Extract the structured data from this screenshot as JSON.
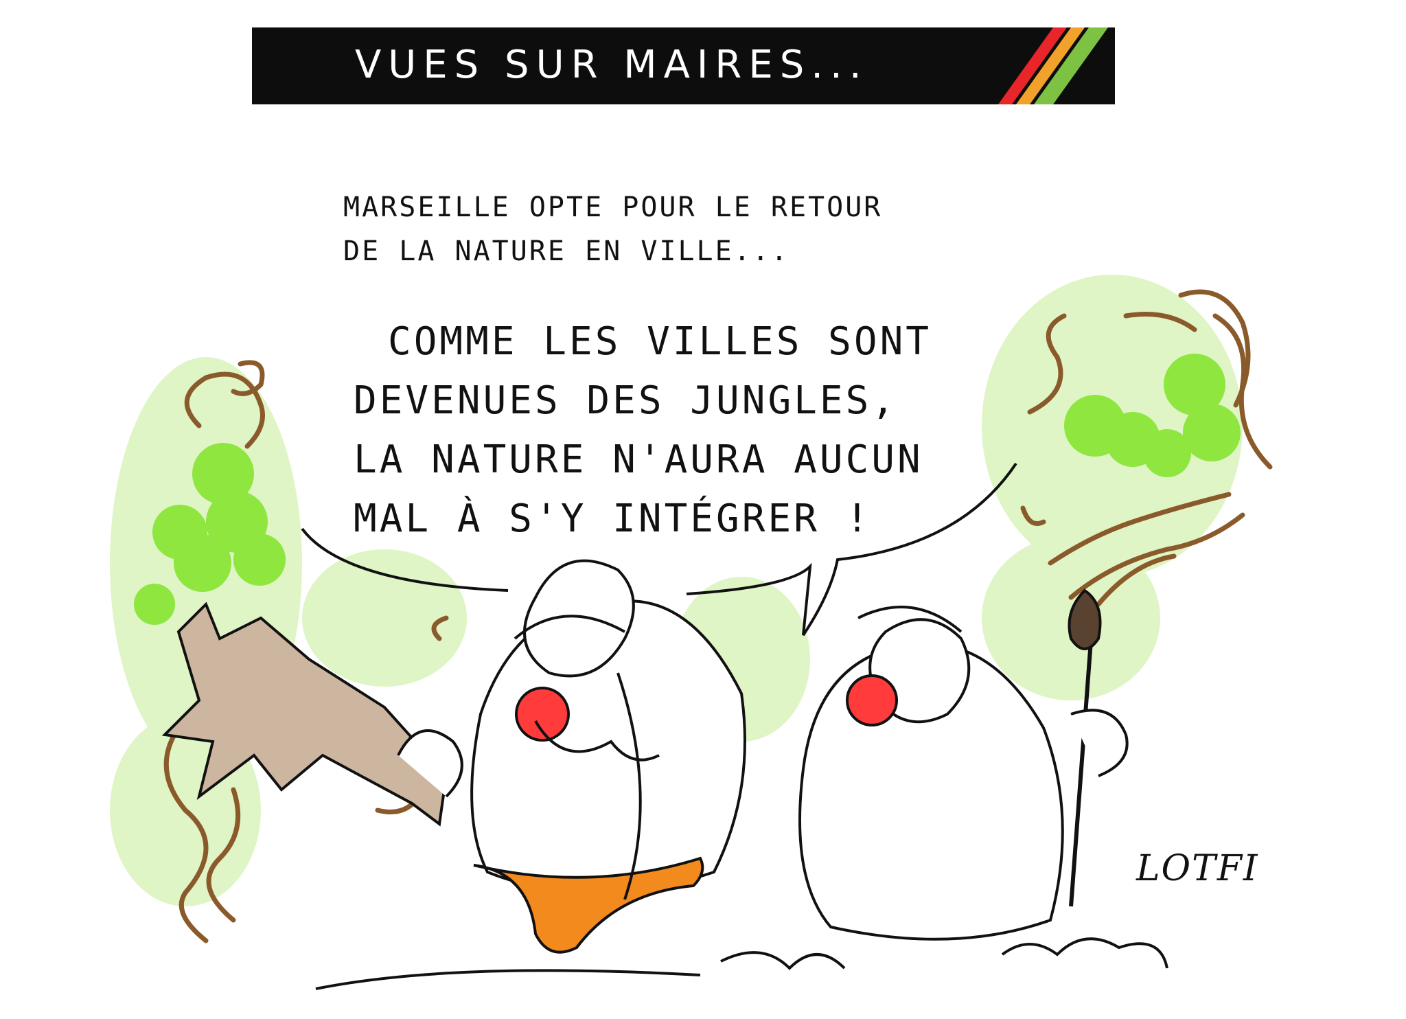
{
  "banner": {
    "title": "VUES SUR MAIRES...",
    "stripe_colors": [
      "#e8262a",
      "#f2a22b",
      "#7dc242"
    ]
  },
  "caption": {
    "line1": "MARSEILLE OPTE POUR LE RETOUR",
    "line2": "DE LA NATURE EN VILLE..."
  },
  "speech": {
    "line1": "COMME LES VILLES SONT",
    "line2": "DEVENUES DES JUNGLES,",
    "line3": "LA NATURE N'AURA AUCUN",
    "line4": "MAL À S'Y INTÉGRER !"
  },
  "signature": "LOTFI",
  "colors": {
    "foliage": "#8ee63f",
    "foliage_light": "#dff5c6",
    "vines": "#8a5a2b",
    "loincloth": "#f28a1e",
    "club": "#cdb6a0",
    "nose": "#ff3b3b"
  }
}
